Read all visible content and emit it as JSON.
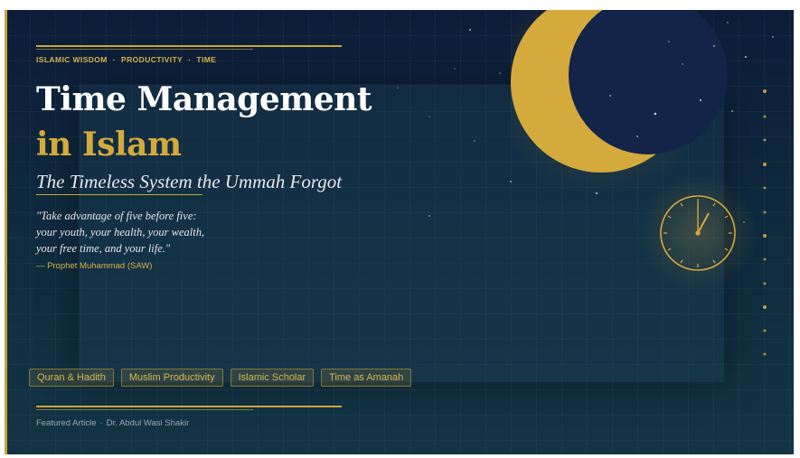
{
  "header": {
    "tags": [
      "ISLAMIC WISDOM",
      "PRODUCTIVITY",
      "TIME"
    ],
    "separator": "·"
  },
  "title": {
    "line1": "Time Management",
    "line2": "in Islam"
  },
  "subtitle": "The Timeless System the Ummah Forgot",
  "quote": {
    "lines": [
      "\"Take advantage of five before five:",
      "your youth, your health, your wealth,",
      "your free time, and your life.\""
    ],
    "attribution": "— Prophet Muhammad (SAW)"
  },
  "chips": [
    "Quran & Hadith",
    "Muslim Productivity",
    "Islamic Scholar",
    "Time as Amanah"
  ],
  "footer": {
    "type": "Featured Article",
    "separator": "·",
    "author": "Dr. Abdul Wasi Shakir"
  },
  "colors": {
    "background": "#0f2a3e",
    "gold": "#c9a43a",
    "title_white": "#ffffff",
    "title_gold": "#d4aa3c",
    "moon_shadow": "#132449"
  },
  "icons": {
    "moon": "crescent-moon-icon",
    "clock": "clock-icon"
  }
}
